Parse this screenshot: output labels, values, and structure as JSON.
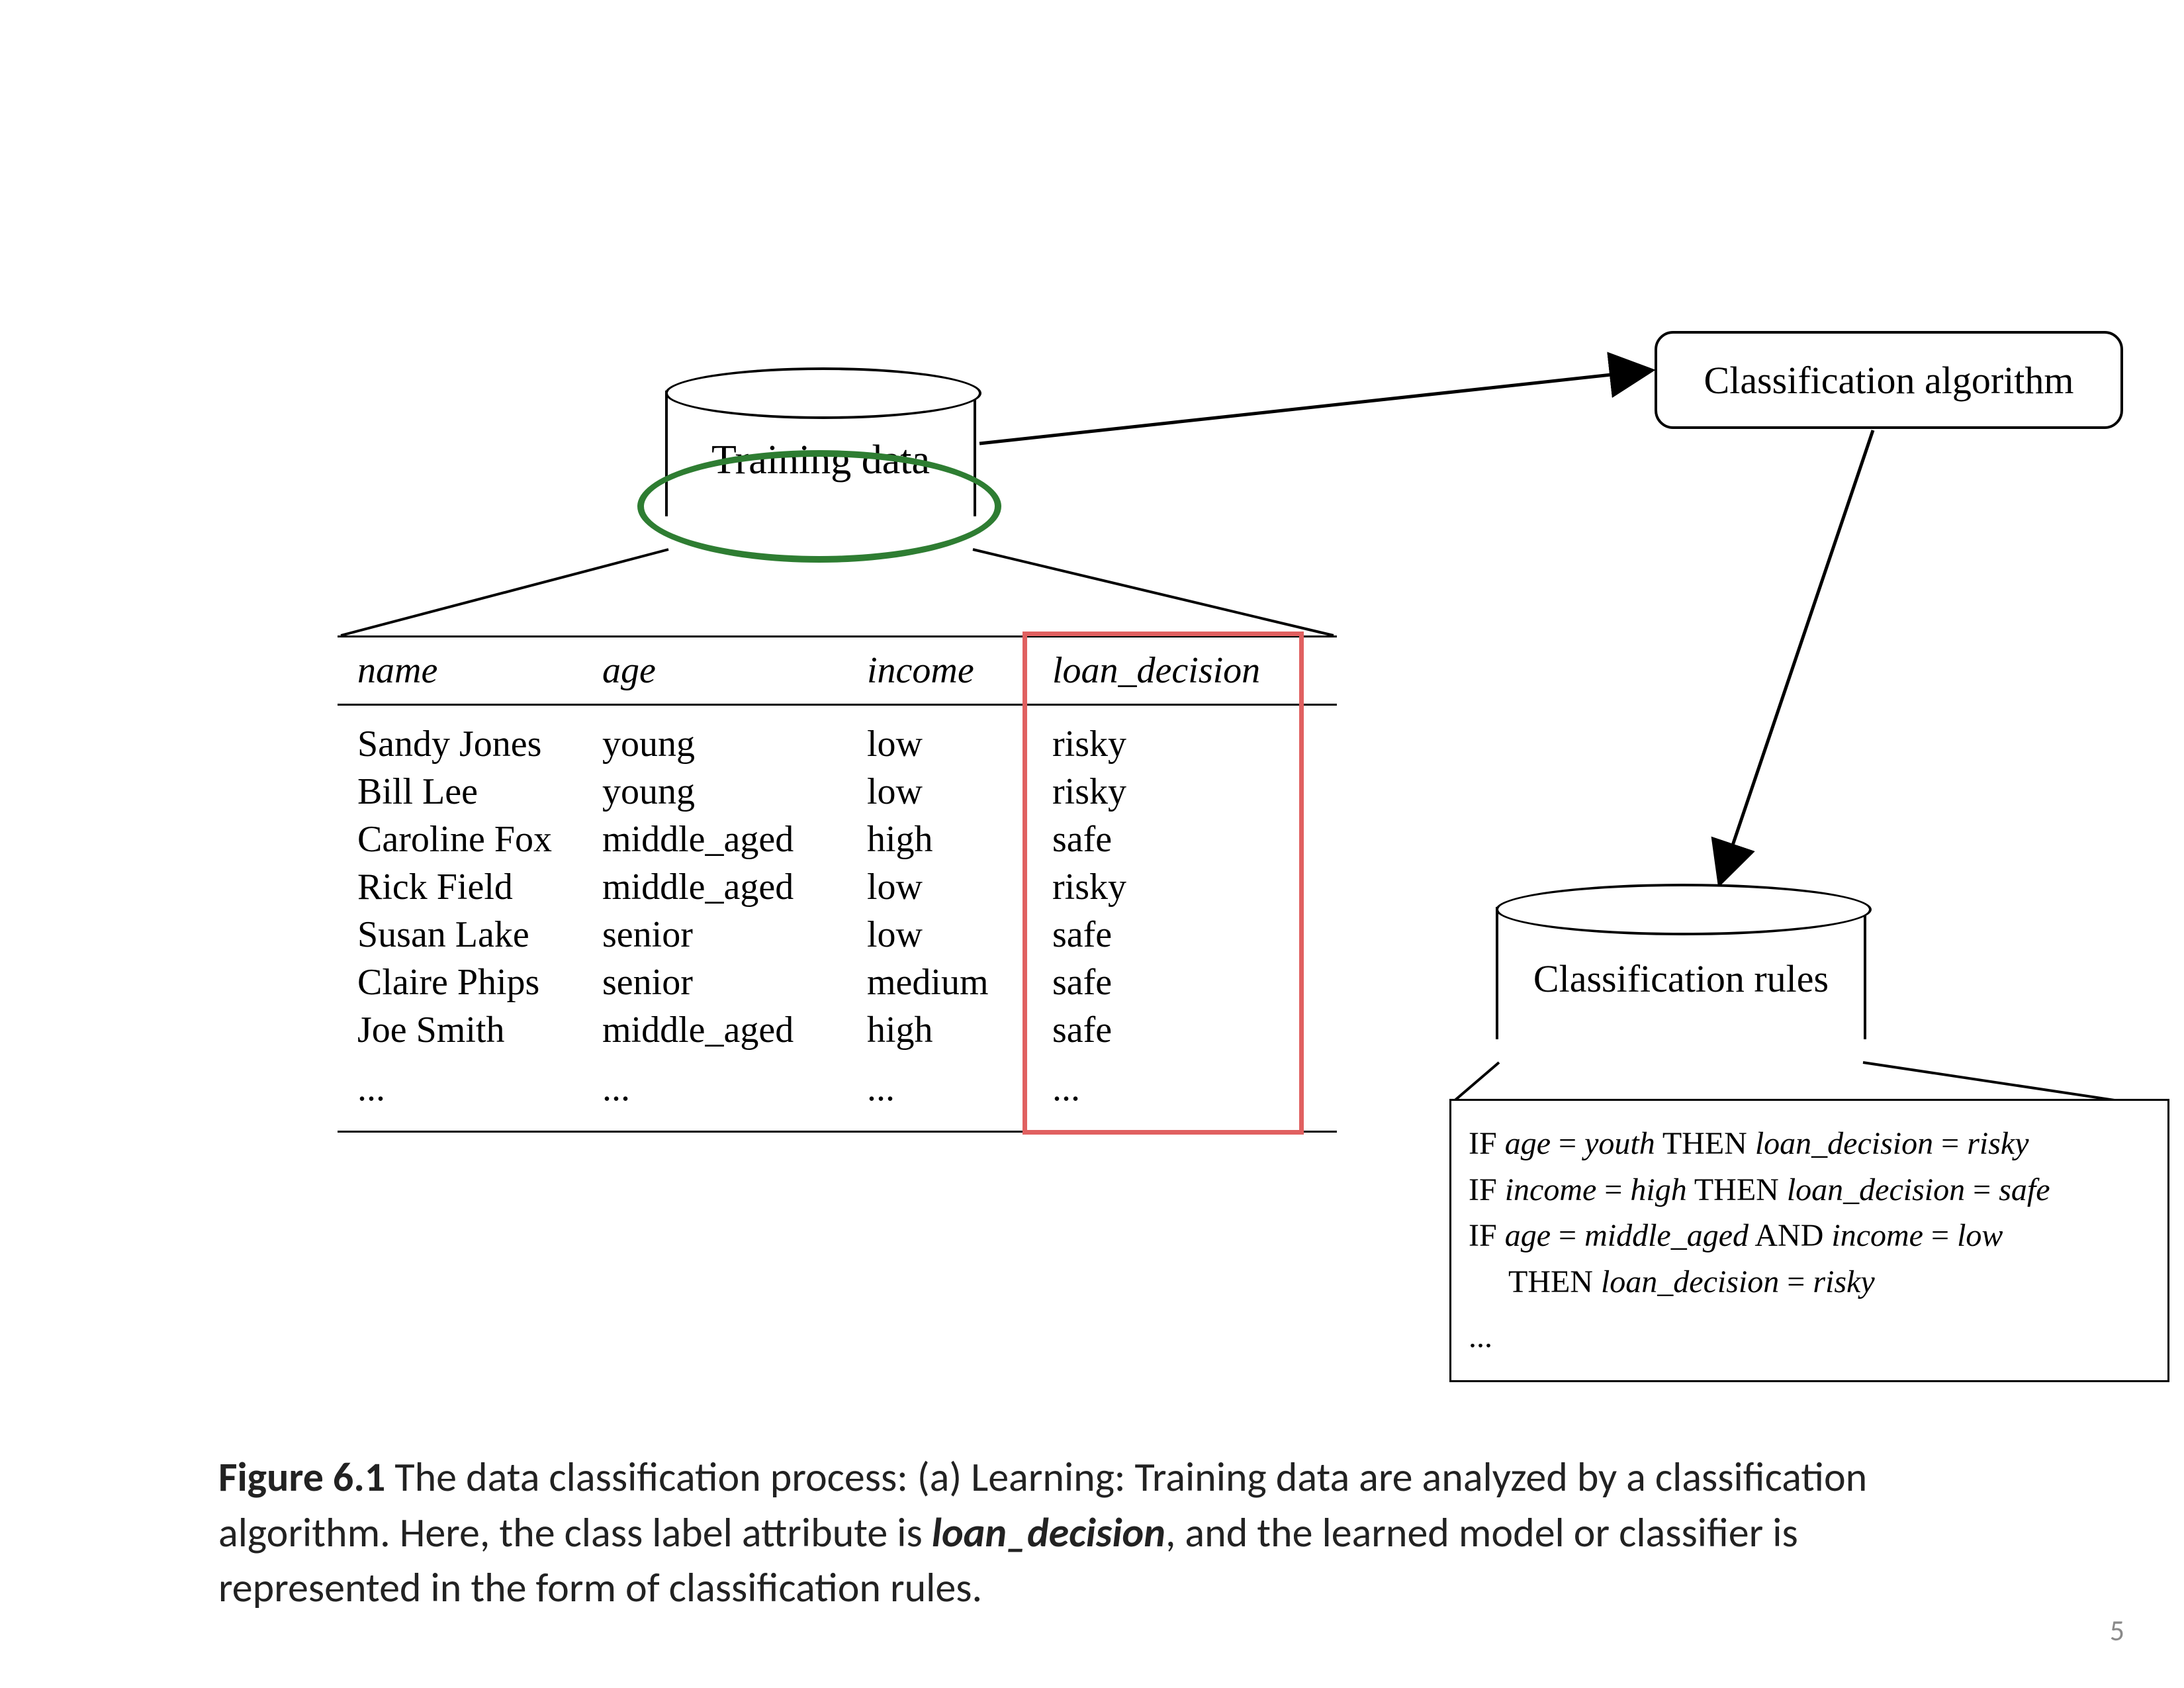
{
  "training_cylinder": {
    "label": "Training data"
  },
  "algo_box": {
    "label": "Classification algorithm"
  },
  "rules_cylinder": {
    "label": "Classification rules"
  },
  "table": {
    "headers": {
      "name": "name",
      "age": "age",
      "income": "income",
      "loan": "loan_decision"
    },
    "rows": [
      {
        "name": "Sandy Jones",
        "age": "young",
        "income": "low",
        "loan": "risky"
      },
      {
        "name": "Bill Lee",
        "age": "young",
        "income": "low",
        "loan": "risky"
      },
      {
        "name": "Caroline Fox",
        "age": "middle_aged",
        "income": "high",
        "loan": "safe"
      },
      {
        "name": "Rick Field",
        "age": "middle_aged",
        "income": "low",
        "loan": "risky"
      },
      {
        "name": "Susan Lake",
        "age": "senior",
        "income": "low",
        "loan": "safe"
      },
      {
        "name": "Claire Phips",
        "age": "senior",
        "income": "medium",
        "loan": "safe"
      },
      {
        "name": "Joe Smith",
        "age": "middle_aged",
        "income": "high",
        "loan": "safe"
      }
    ],
    "ellipsis": "..."
  },
  "rules": {
    "r1": {
      "if": "IF ",
      "v1": "age",
      "eq1": " = ",
      "val1": "youth",
      "then": " THEN ",
      "v2": "loan_decision",
      "eq2": " = ",
      "val2": "risky"
    },
    "r2": {
      "if": "IF ",
      "v1": "income",
      "eq1": " = ",
      "val1": "high",
      "then": " THEN ",
      "v2": "loan_decision",
      "eq2": " = ",
      "val2": "safe"
    },
    "r3": {
      "if": "IF ",
      "v1": "age",
      "eq1": " = ",
      "val1": "middle_aged",
      "and": " AND ",
      "v3": "income",
      "eq3": " = ",
      "val3": "low",
      "then": "THEN ",
      "v2": "loan_decision",
      "eq2": " = ",
      "val2": "risky"
    },
    "ellipsis": "..."
  },
  "caption": {
    "lead": "Figure 6.1",
    "body_a": "  The data classification process: (a) Learning: Training data are analyzed by a classification algorithm. Here, the class label attribute is ",
    "emph": "loan_decision",
    "body_b": ", and the learned model or classifier is represented in the form of classification rules."
  },
  "page_number": "5",
  "colors": {
    "highlight_green": "#2e7d32",
    "highlight_red": "#e06060"
  }
}
